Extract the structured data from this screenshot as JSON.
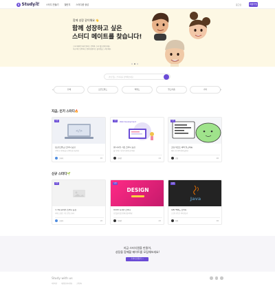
{
  "header": {
    "logo_mark": "S",
    "logo_text": "Study卍",
    "nav": [
      "스터디 만들기",
      "챌린지",
      "스터디룸 생성"
    ],
    "login": "로그인",
    "signup": "회원가입",
    "brand_color": "#6a4bd6"
  },
  "hero": {
    "subtitle": "함께 성장 같이해요 👋",
    "title_line1": "함께 성장하고 싶은",
    "title_line2": "스터디 메이트를 찾습니다!",
    "desc_line1": "스터디메이트에서 원하는 분야의 스터디를 찾아보세요.",
    "desc_line2": "지금 바로 참여하고 함께 성장하는 즐거움을 느껴보세요.",
    "background": "#fdf8e4"
  },
  "search": {
    "placeholder": "관심 있는 스터디를 검색해보세요"
  },
  "categories": {
    "prev_icon": "‹",
    "next_icon": "›",
    "items": [
      "전체",
      "프론트엔드",
      "백엔드",
      "알고리즘",
      "기타"
    ]
  },
  "popular": {
    "title": "지금, 인기 스터디🔥",
    "cards": [
      {
        "badge": "모집",
        "title": "[프론트엔드] 스터디 모집",
        "desc": "리액트로 함께 웹 프로젝트를 만들어요",
        "author": "스터디",
        "count": "3/5"
      },
      {
        "badge": "모집",
        "title": "웹 디자인 기초 스터디 모집",
        "desc": "웹 디자인 기초부터 함께 공부해요",
        "author": "디자인",
        "count": "2/4"
      },
      {
        "badge": "모집",
        "title": "코딩 테스트 대비 알고리즘",
        "desc": "매일 한 문제씩 함께 풀어요",
        "author": "코딩",
        "count": "4/6"
      }
    ],
    "web_dev_text": "Web Development"
  },
  "newest": {
    "title": "신규 스터디🌱",
    "cards": [
      {
        "badge": "모집",
        "title": "주 3회 온라인 스터디 모집",
        "desc": "자바스크립트 기초 문법 스터디",
        "author": "스터디",
        "count": "1/5"
      },
      {
        "badge": "모집",
        "title": "UI/UX 디자인 스터디",
        "desc": "포트폴리오를 함께 만들어봐요",
        "author": "디자인",
        "count": "2/5"
      },
      {
        "badge": "모집",
        "title": "자바 백엔드 스터디",
        "desc": "스프링 부트로 서버 만들기",
        "author": "자바",
        "count": "3/6"
      }
    ],
    "design_text": "DESIGN",
    "java_text": "Java"
  },
  "cta": {
    "line1": "지금 스터디원을 만들어,",
    "line2": "성장을 함께할 메이트를 모집해보세요!",
    "button": "스터디 만들기 →"
  },
  "footer": {
    "logo": "Study with us",
    "links": [
      "이용약관",
      "개인정보처리방침",
      "고객센터"
    ]
  }
}
